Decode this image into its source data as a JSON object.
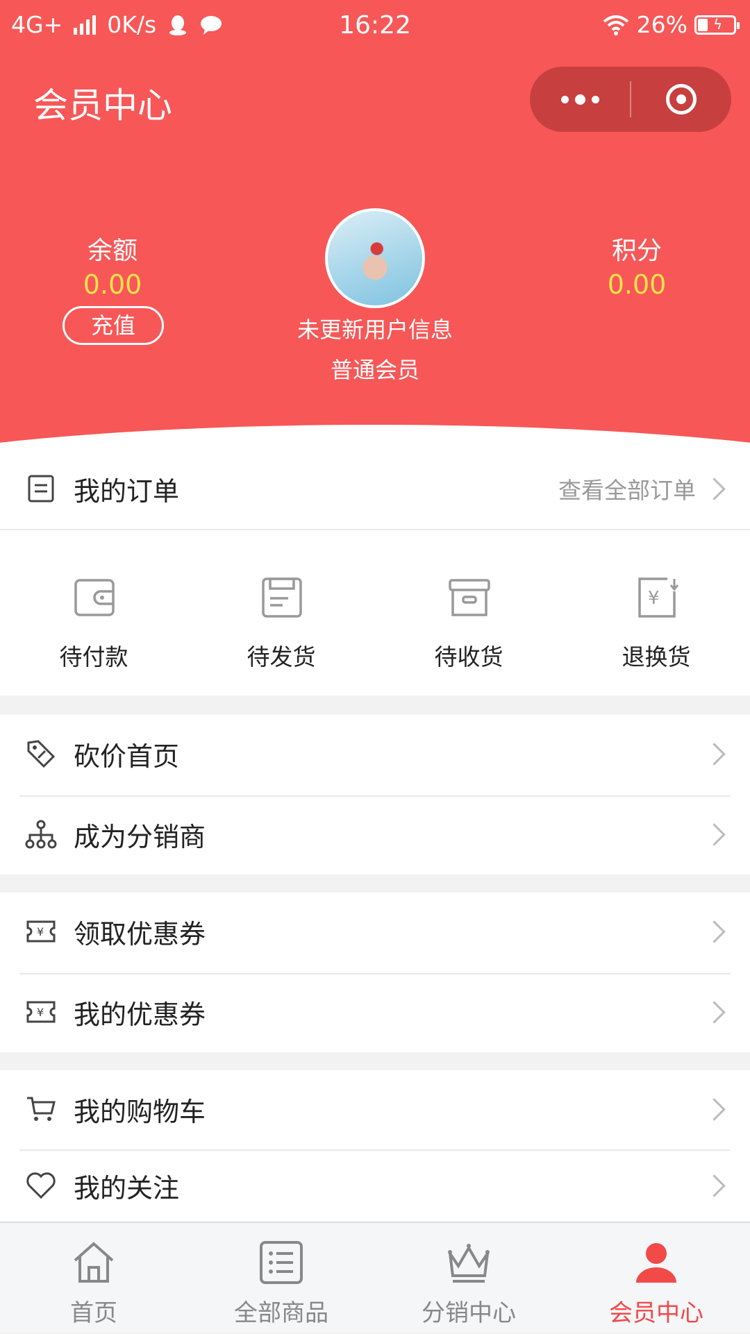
{
  "status_bar": {
    "network": "4G+",
    "speed": "0K/s",
    "time": "16:22",
    "battery": "26%"
  },
  "header": {
    "title": "会员中心",
    "balance_label": "余额",
    "balance_value": "0.00",
    "recharge_label": "充值",
    "points_label": "积分",
    "points_value": "0.00",
    "user_name": "未更新用户信息",
    "user_level": "普通会员"
  },
  "orders": {
    "title": "我的订单",
    "view_all": "查看全部订单",
    "statuses": [
      {
        "label": "待付款",
        "icon": "wallet-icon"
      },
      {
        "label": "待发货",
        "icon": "package-icon"
      },
      {
        "label": "待收货",
        "icon": "box-icon"
      },
      {
        "label": "退换货",
        "icon": "refund-icon"
      }
    ]
  },
  "menu": [
    {
      "label": "砍价首页",
      "icon": "tag-icon"
    },
    {
      "label": "成为分销商",
      "icon": "network-icon"
    },
    {
      "label": "领取优惠券",
      "icon": "coupon-icon"
    },
    {
      "label": "我的优惠券",
      "icon": "coupon-icon"
    },
    {
      "label": "我的购物车",
      "icon": "cart-icon"
    },
    {
      "label": "我的关注",
      "icon": "heart-icon"
    }
  ],
  "tabbar": [
    {
      "label": "首页",
      "icon": "home-icon"
    },
    {
      "label": "全部商品",
      "icon": "list-icon"
    },
    {
      "label": "分销中心",
      "icon": "crown-icon"
    },
    {
      "label": "会员中心",
      "icon": "user-icon",
      "active": true
    }
  ],
  "colors": {
    "header_red": "#f75757",
    "capsule": "#c83f3f",
    "value_yellow": "#ffe24a",
    "active_tab": "#f24949"
  }
}
